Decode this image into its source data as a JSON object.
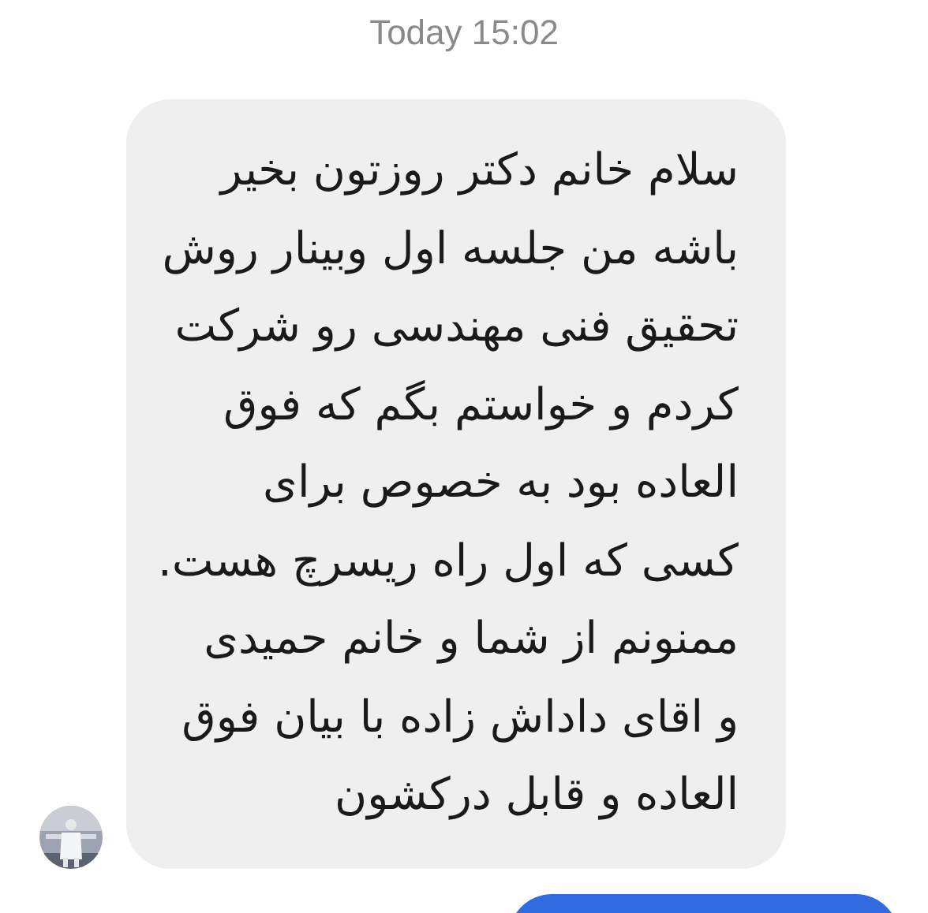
{
  "timestamp": "Today 15:02",
  "messages": [
    {
      "kind": "incoming",
      "lines": [
        "سلام خانم دکتر روزتون بخیر",
        "باشه من جلسه اول وبینار روش",
        "تحقیق فنی مهندسی رو شرکت",
        "کردم و خواستم بگم که فوق",
        "العاده بود به خصوص برای",
        "کسی که اول راه ریسرچ هست.",
        "ممنونم از شما و خانم حمیدی",
        "و اقای داداش زاده با بیان فوق",
        "العاده و قابل درکشون"
      ]
    },
    {
      "kind": "outgoing"
    }
  ]
}
